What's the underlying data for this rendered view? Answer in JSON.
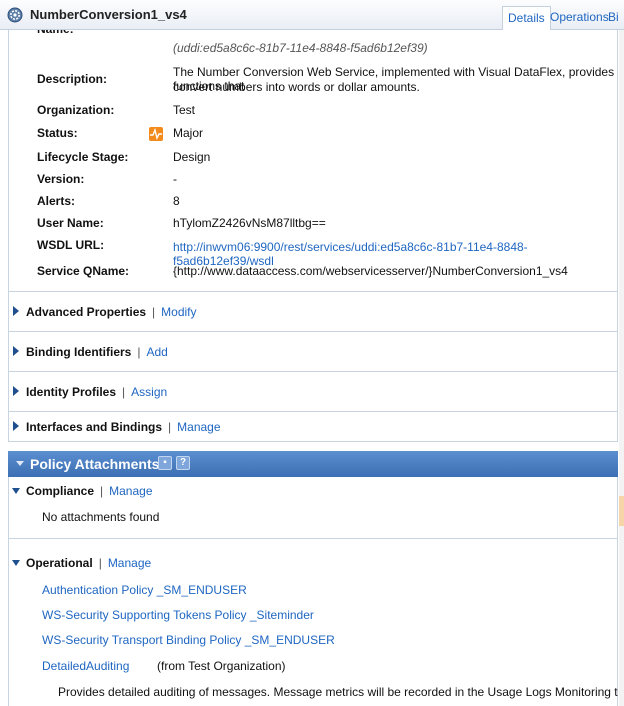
{
  "header": {
    "title": "NumberConversion1_vs4",
    "tabs": [
      "Details",
      "Operations",
      "Bi"
    ]
  },
  "properties": {
    "key_value": "(uddi:ed5a8c6c-81b7-11e4-8848-f5ad6b12ef39)",
    "description_label": "Description:",
    "description_line1": "The Number Conversion Web Service, implemented with Visual DataFlex, provides functions that",
    "description_line2": "convert numbers into words or dollar amounts.",
    "organization_label": "Organization:",
    "organization": "Test",
    "status_label": "Status:",
    "status": "Major",
    "lifecycle_label": "Lifecycle Stage:",
    "lifecycle": "Design",
    "version_label": "Version:",
    "version": "-",
    "alerts_label": "Alerts:",
    "alerts": "8",
    "username_label": "User Name:",
    "username": "hTylomZ2426vNsM87lltbg==",
    "wsdl_label": "WSDL URL:",
    "wsdl": "http://inwvm06:9900/rest/services/uddi:ed5a8c6c-81b7-11e4-8848-f5ad6b12ef39/wsdl",
    "qname_label": "Service QName:",
    "qname": "{http://www.dataaccess.com/webservicesserver/}NumberConversion1_vs4"
  },
  "sections": [
    {
      "title": "Advanced Properties",
      "action": "Modify"
    },
    {
      "title": "Binding Identifiers",
      "action": "Add"
    },
    {
      "title": "Identity Profiles",
      "action": "Assign"
    },
    {
      "title": "Interfaces and Bindings",
      "action": "Manage"
    }
  ],
  "policy": {
    "title": "Policy Attachments",
    "compliance_title": "Compliance",
    "compliance_action": "Manage",
    "compliance_empty": "No attachments found",
    "operational_title": "Operational",
    "operational_action": "Manage",
    "items": [
      "Authentication Policy _SM_ENDUSER",
      "WS-Security Supporting Tokens Policy _Siteminder",
      "WS-Security Transport Binding Policy _SM_ENDUSER",
      "DetailedAuditing"
    ],
    "detailed_origin": "(from Test Organization)",
    "detailed_desc": "Provides detailed auditing of messages. Message metrics will be recorded in the Usage Logs Monitoring tab as well as the"
  }
}
